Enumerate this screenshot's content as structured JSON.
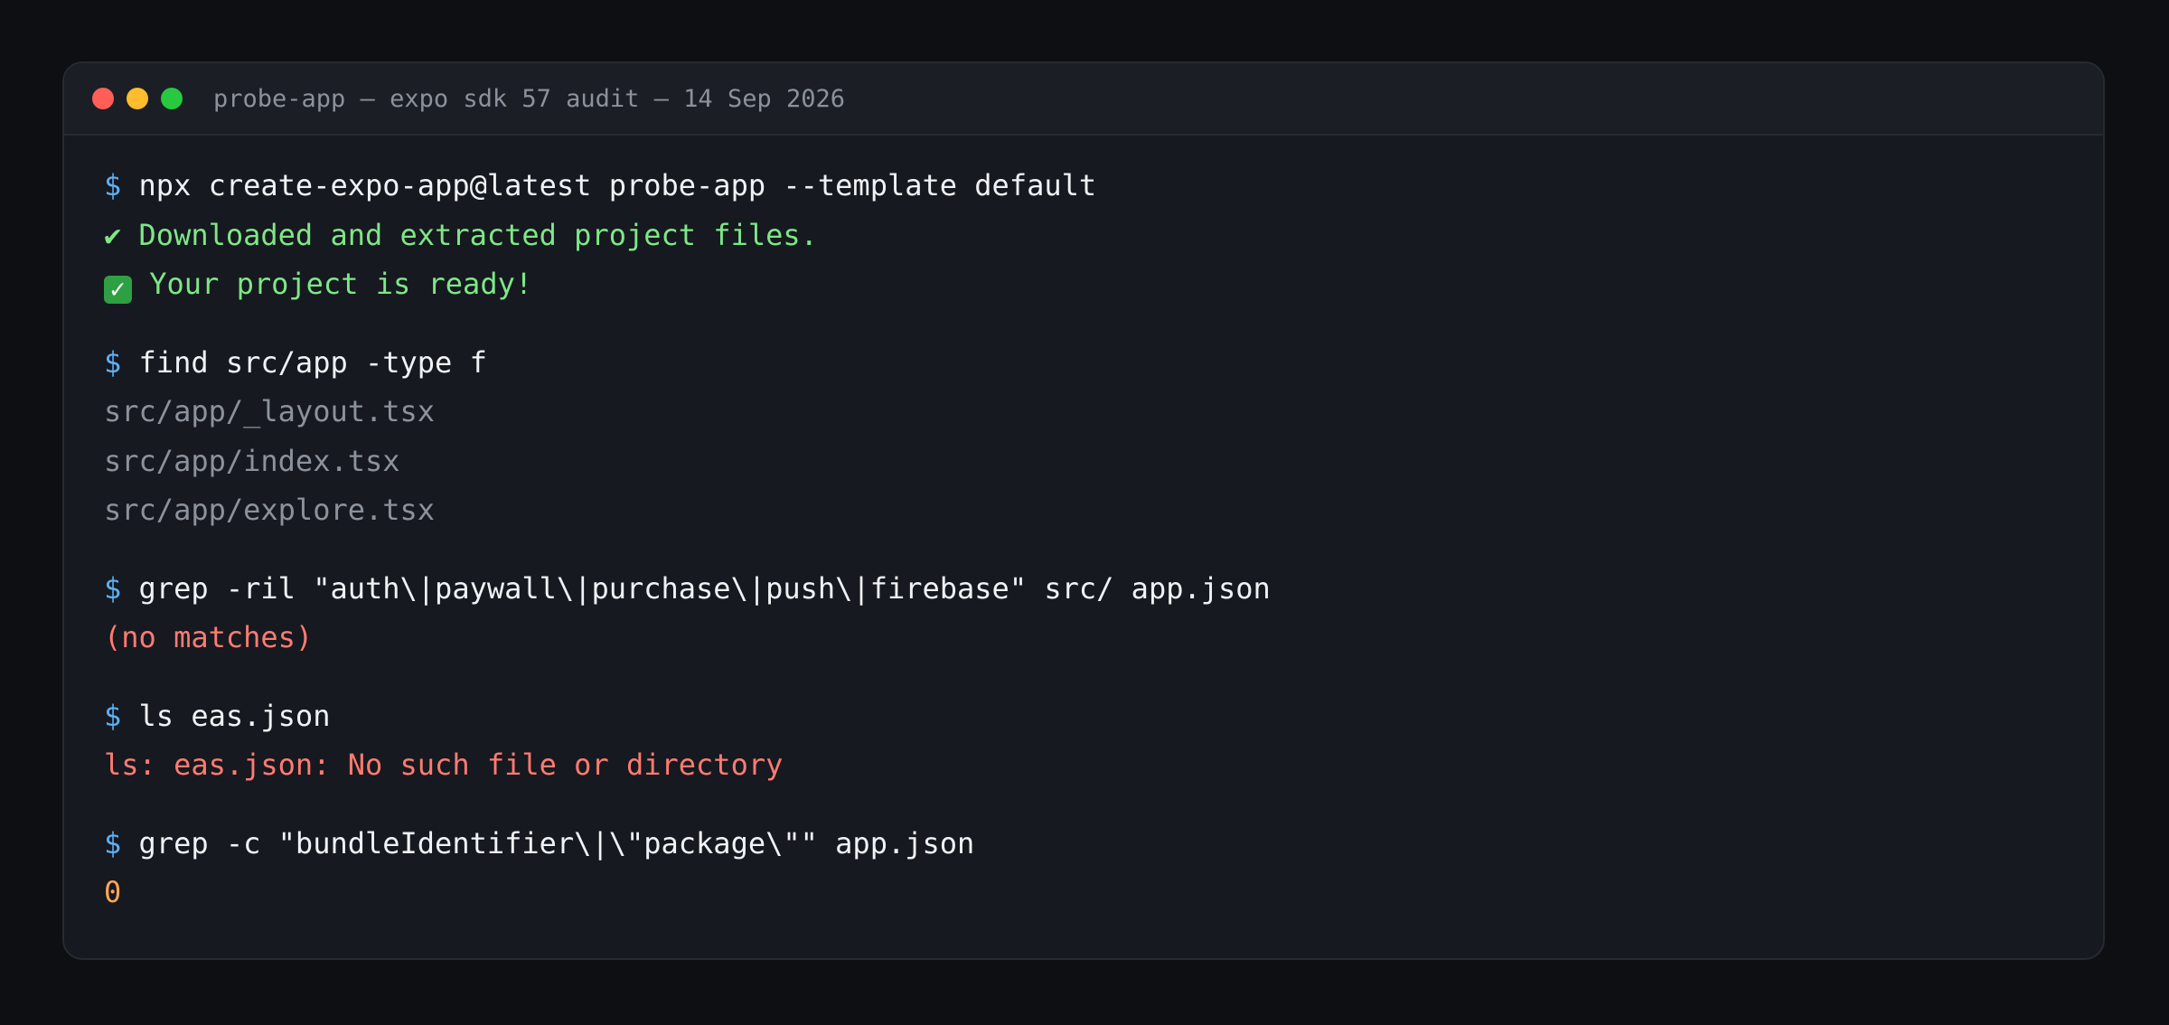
{
  "window": {
    "title": "probe-app — expo sdk 57 audit — 14 Sep 2026"
  },
  "prompt_symbol": "$",
  "blocks": [
    {
      "command": "npx create-expo-app@latest probe-app --template default",
      "output": [
        {
          "text": "✔ Downloaded and extracted project files.",
          "kind": "ok"
        },
        {
          "icon": "✓",
          "text": " Your project is ready!",
          "kind": "ok"
        }
      ]
    },
    {
      "command": "find src/app -type f",
      "output": [
        {
          "text": "src/app/_layout.tsx",
          "kind": "muted"
        },
        {
          "text": "src/app/index.tsx",
          "kind": "muted"
        },
        {
          "text": "src/app/explore.tsx",
          "kind": "muted"
        }
      ]
    },
    {
      "command": "grep -ril \"auth\\|paywall\\|purchase\\|push\\|firebase\" src/ app.json",
      "output": [
        {
          "text": "(no matches)",
          "kind": "err"
        }
      ]
    },
    {
      "command": "ls eas.json",
      "output": [
        {
          "text": "ls: eas.json: No such file or directory",
          "kind": "err"
        }
      ]
    },
    {
      "command": "grep -c \"bundleIdentifier\\|\\\"package\\\"\" app.json",
      "output": [
        {
          "text": "0",
          "kind": "num"
        }
      ]
    }
  ],
  "colors": {
    "prompt": "#5eb0f5",
    "ok": "#7ee787",
    "muted": "#8b929c",
    "err": "#ff7b72",
    "num": "#ffa657"
  }
}
